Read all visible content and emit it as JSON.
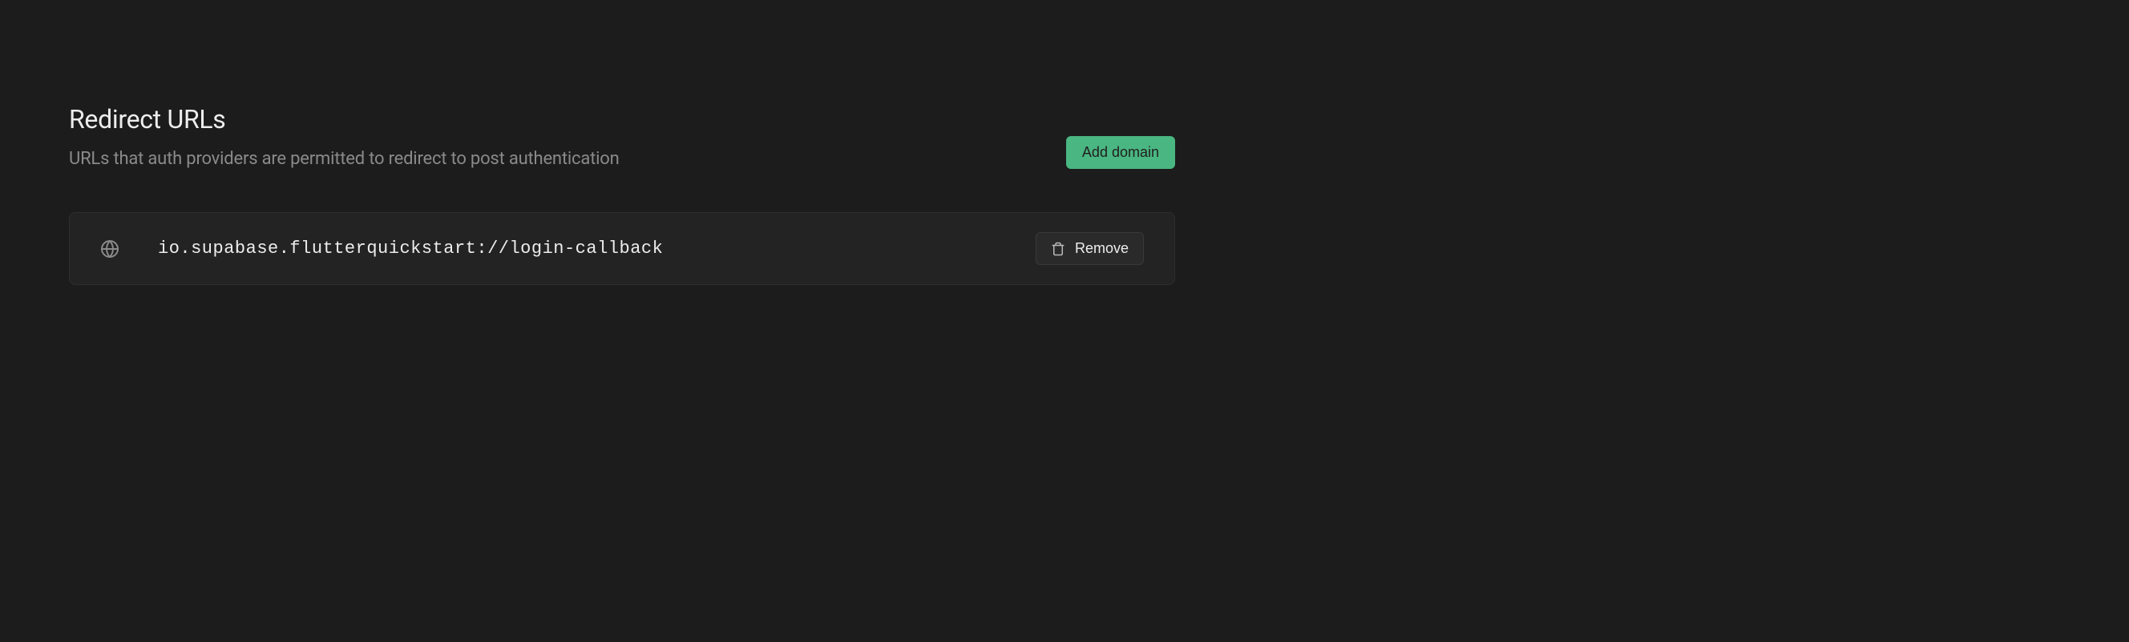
{
  "section": {
    "title": "Redirect URLs",
    "description": "URLs that auth providers are permitted to redirect to post authentication"
  },
  "actions": {
    "add_domain_label": "Add domain"
  },
  "urls": [
    {
      "value": "io.supabase.flutterquickstart://login-callback",
      "remove_label": "Remove"
    }
  ]
}
